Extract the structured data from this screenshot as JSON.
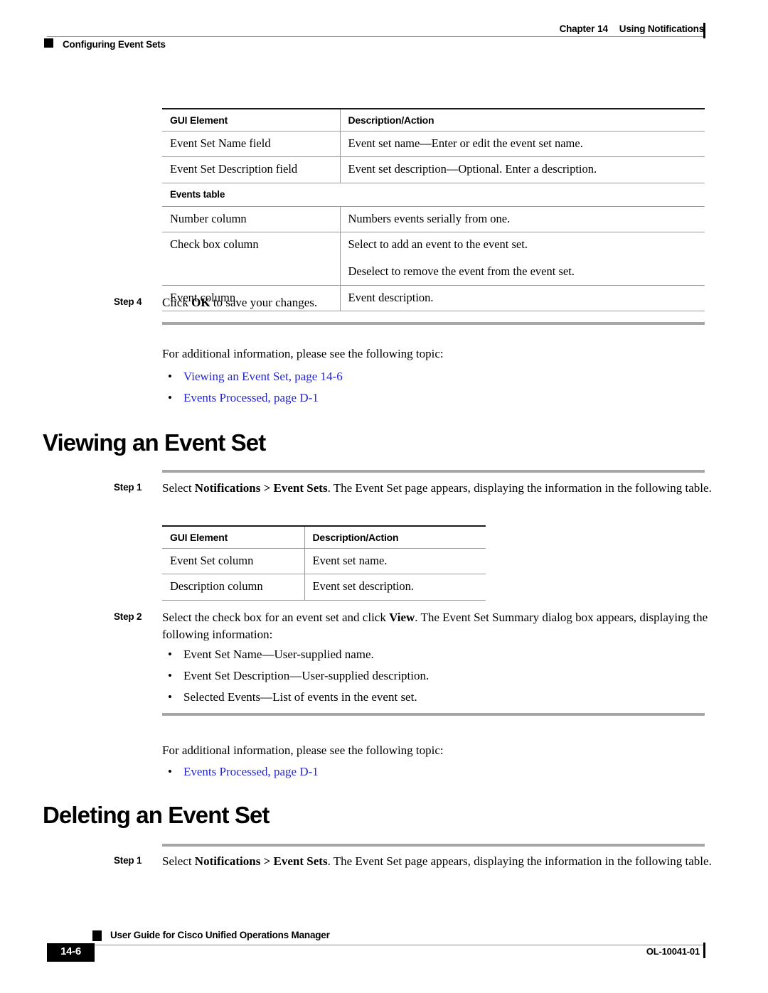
{
  "header": {
    "chapter_label": "Chapter",
    "chapter_number": "14",
    "chapter_title": "Using Notifications",
    "section_title": "Configuring Event Sets"
  },
  "table1": {
    "headers": [
      "GUI Element",
      "Description/Action"
    ],
    "rows": [
      {
        "type": "row",
        "cells": [
          "Event Set Name field",
          "Event set name—Enter or edit the event set name."
        ]
      },
      {
        "type": "row",
        "cells": [
          "Event Set Description field",
          "Event set description—Optional. Enter a description."
        ]
      },
      {
        "type": "subhead",
        "label": "Events table"
      },
      {
        "type": "row",
        "cells": [
          "Number column",
          "Numbers events serially from one."
        ]
      },
      {
        "type": "row2",
        "cells": [
          "Check box column",
          "Select to add an event to the event set.",
          "Deselect to remove the event from the event set."
        ]
      },
      {
        "type": "row",
        "cells": [
          "Event column",
          "Event description."
        ]
      }
    ]
  },
  "step4": {
    "label": "Step 4",
    "text_pre": "Click ",
    "text_bold": "OK",
    "text_post": " to save your changes."
  },
  "related1": {
    "intro": "For additional information, please see the following topic:",
    "bullets": [
      "Viewing an Event Set, page 14-6",
      "Events Processed, page D-1"
    ]
  },
  "section_viewing": {
    "heading": "Viewing an Event Set",
    "step1": {
      "label": "Step 1",
      "line1_pre": "Select ",
      "line1_bold": "Notifications > Event Sets",
      "line1_post": ". The Event Set page appears, displaying the information in the",
      "line2": "following table."
    },
    "step2": {
      "label": "Step 2",
      "line1_pre": "Select the check box for an event set and click ",
      "line1_bold": "View",
      "line1_post": ". The Event Set Summary dialog box appears,",
      "line2": "displaying the following information:",
      "bullets": [
        "Event Set Name—User-supplied name.",
        "Event Set Description—User-supplied description.",
        "Selected Events—List of events in the event set."
      ]
    }
  },
  "table2": {
    "headers": [
      "GUI Element",
      "Description/Action"
    ],
    "rows": [
      {
        "type": "row",
        "cells": [
          "Event Set column",
          "Event set name."
        ]
      },
      {
        "type": "row",
        "cells": [
          "Description column",
          "Event set description."
        ]
      }
    ]
  },
  "related2": {
    "intro": "For additional information, please see the following topic:",
    "bullets": [
      "Events Processed, page D-1"
    ]
  },
  "section_deleting": {
    "heading": "Deleting an Event Set",
    "step1": {
      "label": "Step 1",
      "line1_pre": "Select ",
      "line1_bold": "Notifications > Event Sets",
      "line1_post": ". The Event Set page appears, displaying the information in the",
      "line2": "following table."
    }
  },
  "footer": {
    "guide_title": "User Guide for Cisco Unified Operations Manager",
    "page_number": "14-6",
    "doc_id": "OL-10041-01"
  },
  "colors": {
    "link": "#2626CC",
    "rule_gray": "#A6A6A6",
    "table_rule": "#9A9A9A",
    "table_top_rule": "#1A1A1A"
  }
}
